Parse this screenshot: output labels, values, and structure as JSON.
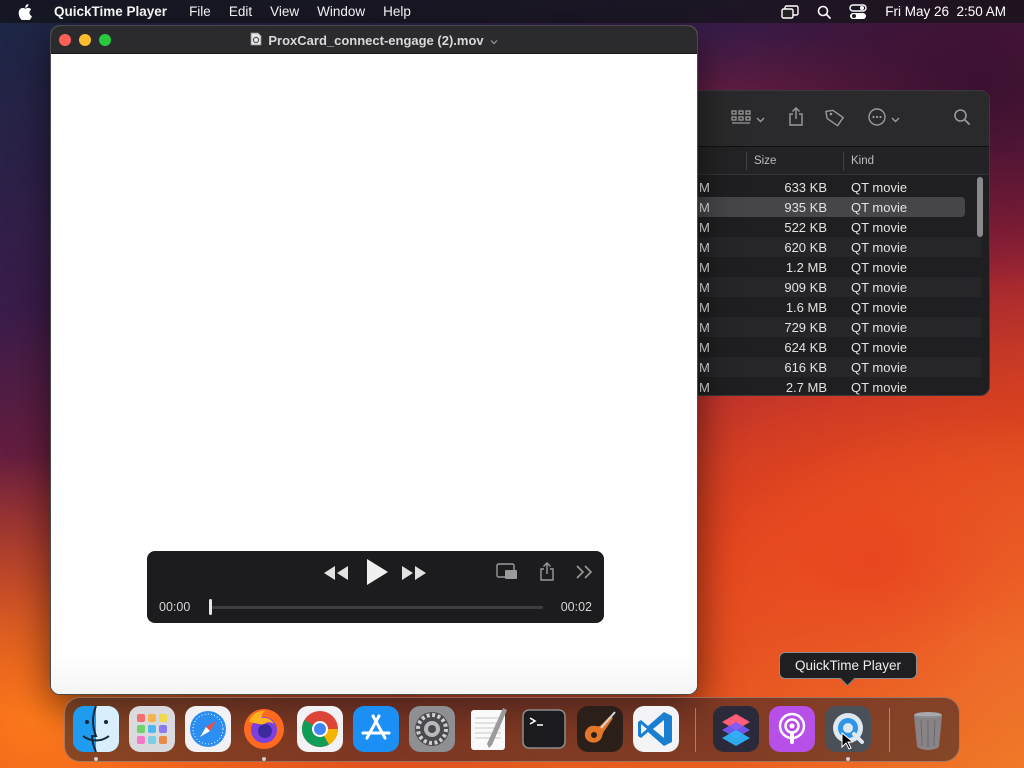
{
  "menubar": {
    "app_name": "QuickTime Player",
    "menus": [
      "File",
      "Edit",
      "View",
      "Window",
      "Help"
    ],
    "clock": "Fri May 26  2:50 AM"
  },
  "quicktime": {
    "window_title": "ProxCard_connect-engage (2).mov",
    "current_time": "00:00",
    "duration": "00:02",
    "progress": 0.0
  },
  "finder": {
    "columns": {
      "size": "Size",
      "kind": "Kind"
    },
    "rows": [
      {
        "date": "M",
        "size": "633 KB",
        "kind": "QT movie",
        "selected": false
      },
      {
        "date": "M",
        "size": "935 KB",
        "kind": "QT movie",
        "selected": true
      },
      {
        "date": "M",
        "size": "522 KB",
        "kind": "QT movie",
        "selected": false
      },
      {
        "date": "M",
        "size": "620 KB",
        "kind": "QT movie",
        "selected": false
      },
      {
        "date": "M",
        "size": "1.2 MB",
        "kind": "QT movie",
        "selected": false
      },
      {
        "date": "M",
        "size": "909 KB",
        "kind": "QT movie",
        "selected": false
      },
      {
        "date": "M",
        "size": "1.6 MB",
        "kind": "QT movie",
        "selected": false
      },
      {
        "date": "M",
        "size": "729 KB",
        "kind": "QT movie",
        "selected": false
      },
      {
        "date": "M",
        "size": "624 KB",
        "kind": "QT movie",
        "selected": false
      },
      {
        "date": "M",
        "size": "616 KB",
        "kind": "QT movie",
        "selected": false
      },
      {
        "date": "M",
        "size": "2.7 MB",
        "kind": "QT movie",
        "selected": false
      }
    ]
  },
  "dock": {
    "tooltip": "QuickTime Player",
    "apps": [
      "finder",
      "launchpad",
      "safari",
      "firefox",
      "chrome",
      "app-store",
      "system-preferences",
      "textedit",
      "terminal",
      "garageband",
      "vscode",
      "shortcuts",
      "podcasts",
      "quicktime",
      "trash"
    ]
  }
}
